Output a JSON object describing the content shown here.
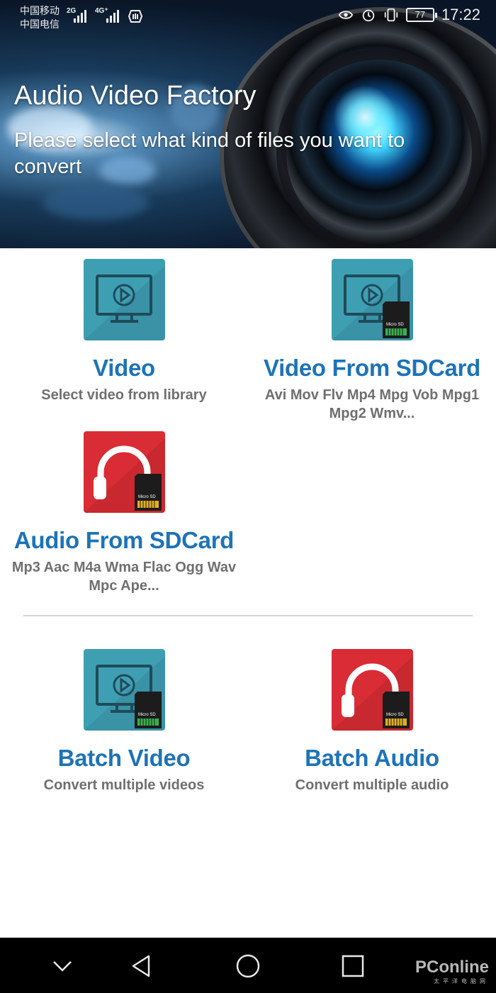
{
  "status_bar": {
    "carrier_1": "中国移动",
    "carrier_2": "中国电信",
    "net_1": "2G",
    "net_2": "4G⁺",
    "battery": "77",
    "time": "17:22"
  },
  "header": {
    "title": "Audio Video Factory",
    "subtitle": "Please select what kind of files you want to convert"
  },
  "options": {
    "video": {
      "title": "Video",
      "desc": "Select video from library",
      "icon": "monitor-play-icon",
      "color": "#3e9fb3"
    },
    "video_sd": {
      "title": "Video From SDCard",
      "desc": "Avi Mov Flv Mp4 Mpg Vob Mpg1 Mpg2 Wmv...",
      "icon": "monitor-play-sdcard-icon",
      "color": "#3e9fb3"
    },
    "audio_sd": {
      "title": "Audio From SDCard",
      "desc": "Mp3 Aac M4a Wma Flac Ogg Wav Mpc Ape...",
      "icon": "headphones-sdcard-icon",
      "color": "#d92c35"
    },
    "batch_video": {
      "title": "Batch Video",
      "desc": "Convert multiple videos",
      "icon": "monitor-play-sdcard-icon",
      "color": "#3e9fb3"
    },
    "batch_audio": {
      "title": "Batch Audio",
      "desc": "Convert multiple audio",
      "icon": "headphones-sdcard-icon",
      "color": "#d92c35"
    }
  },
  "sdcard_label": "Micro SD",
  "nav_bar": {
    "icons": [
      "chevron-down-icon",
      "back-icon",
      "home-icon",
      "recents-icon"
    ]
  },
  "watermark": {
    "brand": "PConline",
    "sub": "太平洋电脑网"
  }
}
